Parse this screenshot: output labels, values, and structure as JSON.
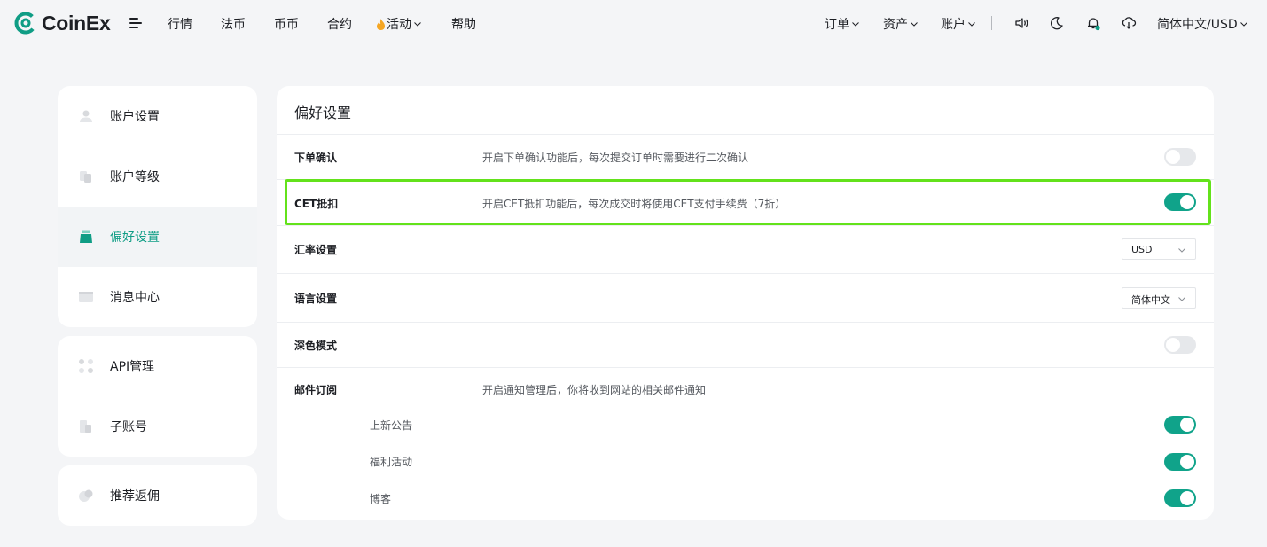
{
  "brand": {
    "name": "CoinEx",
    "accent": "#0f9d85",
    "highlight": "#63e21b"
  },
  "nav": {
    "markets": "行情",
    "fiat": "法币",
    "spot": "币币",
    "futures": "合约",
    "activity": "活动",
    "help": "帮助",
    "orders": "订单",
    "assets": "资产",
    "account": "账户",
    "language_currency": "简体中文/USD"
  },
  "sidebar": {
    "group1": [
      {
        "label": "账户设置",
        "icon": "user-icon"
      },
      {
        "label": "账户等级",
        "icon": "level-icon"
      },
      {
        "label": "偏好设置",
        "icon": "preference-icon",
        "active": true
      },
      {
        "label": "消息中心",
        "icon": "message-icon"
      }
    ],
    "group2": [
      {
        "label": "API管理",
        "icon": "api-icon"
      },
      {
        "label": "子账号",
        "icon": "sub-account-icon"
      }
    ],
    "group3": [
      {
        "label": "推荐返佣",
        "icon": "referral-icon"
      }
    ]
  },
  "main": {
    "title": "偏好设置",
    "rows": {
      "order_confirm": {
        "label": "下单确认",
        "desc": "开启下单确认功能后，每次提交订单时需要进行二次确认",
        "on": false
      },
      "cet_deduct": {
        "label": "CET抵扣",
        "desc": "开启CET抵扣功能后，每次成交时将使用CET支付手续费（7折）",
        "on": true
      },
      "currency": {
        "label": "汇率设置",
        "value": "USD"
      },
      "language": {
        "label": "语言设置",
        "value": "简体中文"
      },
      "dark_mode": {
        "label": "深色模式",
        "on": false
      },
      "email": {
        "label": "邮件订阅",
        "desc": "开启通知管理后，你将收到网站的相关邮件通知",
        "subs": [
          {
            "label": "上新公告",
            "on": true
          },
          {
            "label": "福利活动",
            "on": true
          },
          {
            "label": "博客",
            "on": true
          }
        ]
      }
    }
  }
}
